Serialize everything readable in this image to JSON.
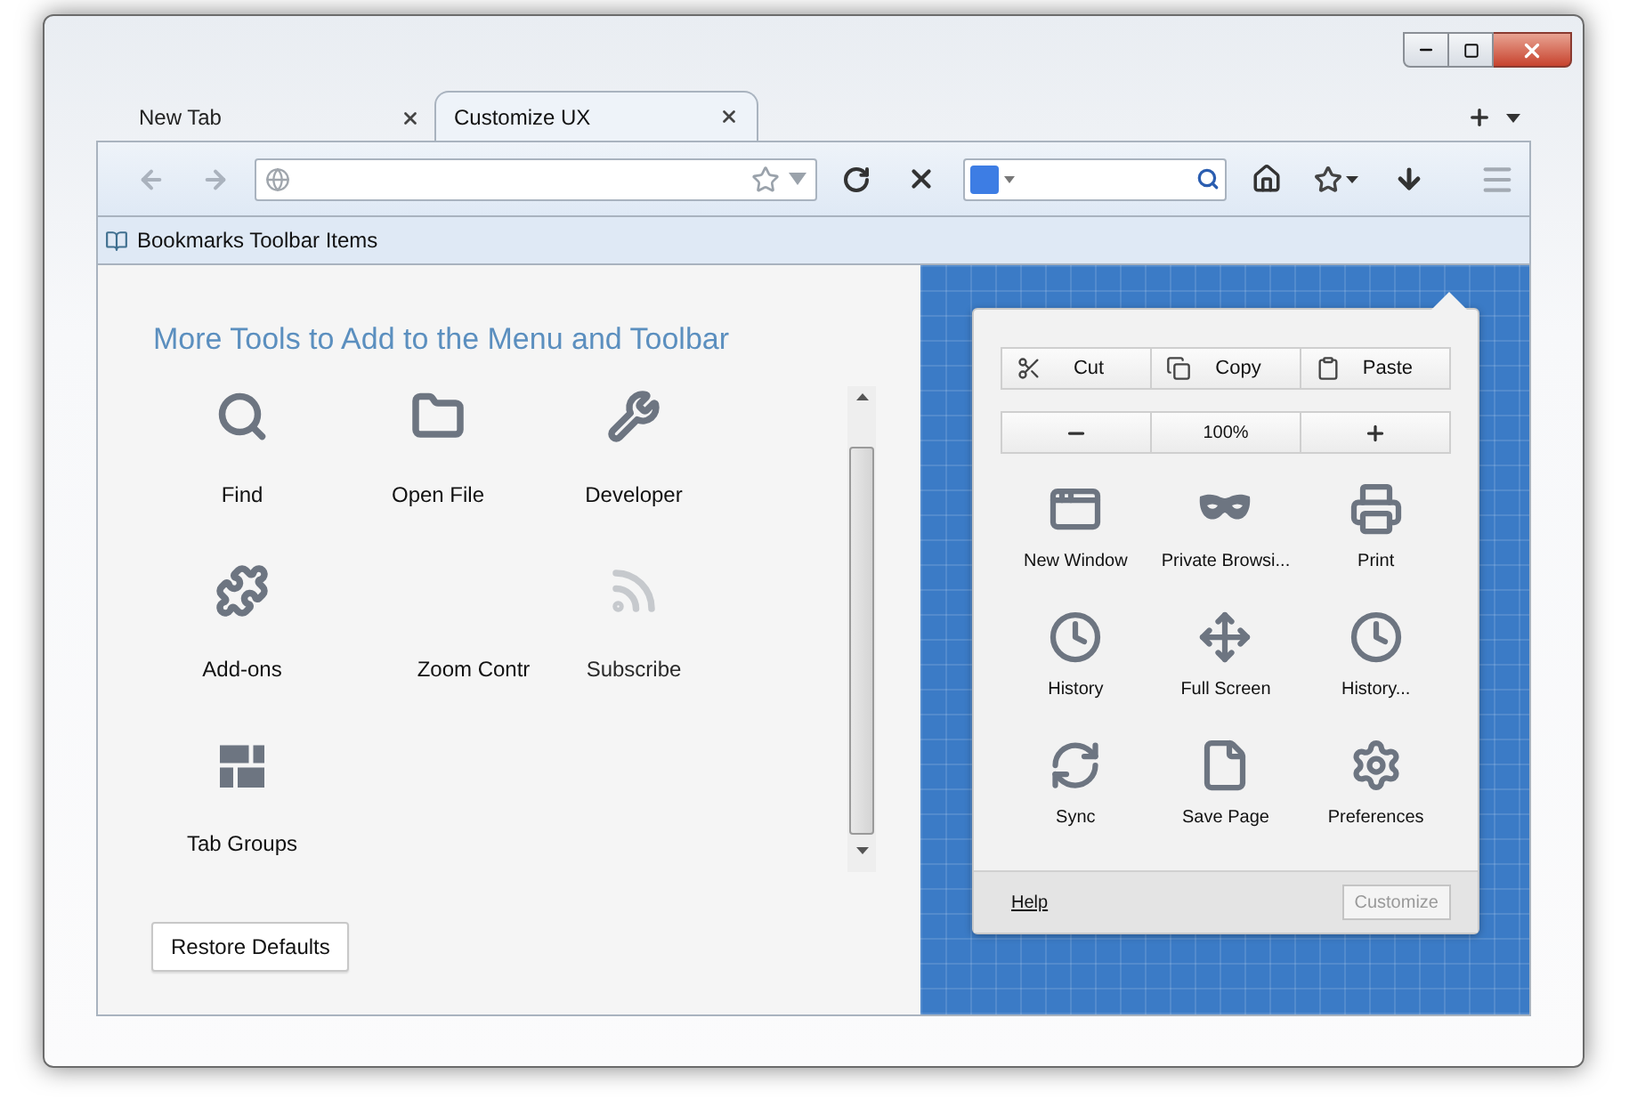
{
  "tabs": [
    {
      "label": "New Tab",
      "selected": false
    },
    {
      "label": "Customize UX",
      "selected": true
    }
  ],
  "bookmarks_toolbar": {
    "label": "Bookmarks Toolbar Items"
  },
  "palette": {
    "title": "More Tools to Add to the Menu and Toolbar",
    "items": [
      {
        "label": "Find",
        "disabled": false
      },
      {
        "label": "Open File",
        "disabled": false
      },
      {
        "label": "Developer",
        "disabled": false
      },
      {
        "label": "Add-ons",
        "disabled": false
      },
      {
        "label": "Zoom Contr",
        "disabled": false
      },
      {
        "label": "Subscribe",
        "disabled": true
      },
      {
        "label": "Tab Groups",
        "disabled": false
      }
    ],
    "restore_button": "Restore Defaults"
  },
  "menu_panel": {
    "edit_buttons": [
      "Cut",
      "Copy",
      "Paste"
    ],
    "zoom_reading": "100%",
    "items": [
      {
        "label": "New Window"
      },
      {
        "label": "Private Browsi..."
      },
      {
        "label": "Print"
      },
      {
        "label": "History"
      },
      {
        "label": "Full Screen"
      },
      {
        "label": "History..."
      },
      {
        "label": "Sync"
      },
      {
        "label": "Save Page"
      },
      {
        "label": "Preferences"
      }
    ],
    "help_link": "Help",
    "customize_button": {
      "label": "Customize",
      "disabled": true
    }
  }
}
